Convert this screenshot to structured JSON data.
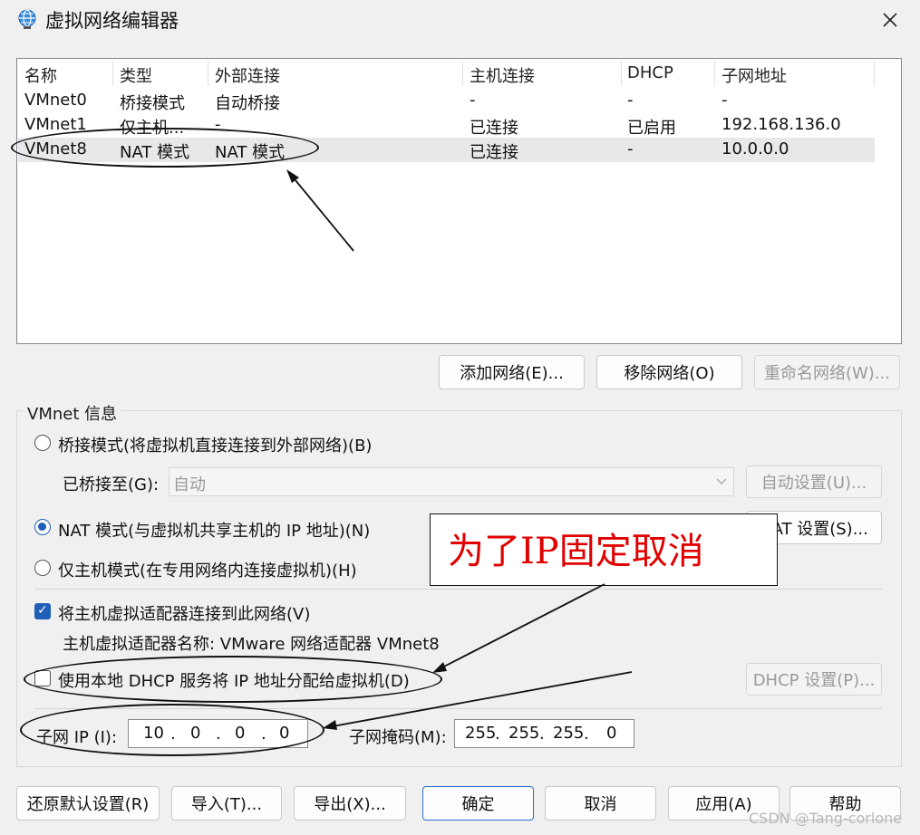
{
  "window": {
    "title": "虚拟网络编辑器",
    "close_glyph": "✕"
  },
  "list": {
    "columns": [
      "名称",
      "类型",
      "外部连接",
      "主机连接",
      "DHCP",
      "子网地址"
    ],
    "rows": [
      [
        "VMnet0",
        "桥接模式",
        "自动桥接",
        "-",
        "-",
        "-"
      ],
      [
        "VMnet1",
        "仅主机...",
        "-",
        "已连接",
        "已启用",
        "192.168.136.0"
      ],
      [
        "VMnet8",
        "NAT 模式",
        "NAT 模式",
        "已连接",
        "-",
        "10.0.0.0"
      ]
    ]
  },
  "list_buttons": {
    "add": "添加网络(E)...",
    "remove": "移除网络(O)",
    "rename": "重命名网络(W)..."
  },
  "info": {
    "group_title": "VMnet 信息",
    "bridge_radio": "桥接模式(将虚拟机直接连接到外部网络)(B)",
    "bridged_to_label": "已桥接至(G):",
    "bridged_to_value": "自动",
    "auto_settings": "自动设置(U)...",
    "nat_radio": "NAT 模式(与虚拟机共享主机的 IP 地址)(N)",
    "nat_settings": "NAT 设置(S)...",
    "hostonly_radio": "仅主机模式(在专用网络内连接虚拟机)(H)",
    "connect_adapter": "将主机虚拟适配器连接到此网络(V)",
    "adapter_name": "主机虚拟适配器名称: VMware 网络适配器 VMnet8",
    "use_dhcp": "使用本地 DHCP 服务将 IP 地址分配给虚拟机(D)",
    "dhcp_settings": "DHCP 设置(P)...",
    "subnet_ip_label": "子网 IP (I):",
    "subnet_ip": [
      "10",
      "0",
      "0",
      "0"
    ],
    "subnet_mask_label": "子网掩码(M):",
    "subnet_mask": [
      "255",
      "255",
      "255",
      "0"
    ],
    "selected_mode": "nat",
    "connect_adapter_checked": true,
    "use_dhcp_checked": false
  },
  "annotation": {
    "text": "为了IP固定取消",
    "color": "#e00000"
  },
  "footer": {
    "restore": "还原默认设置(R)",
    "import": "导入(T)...",
    "export": "导出(X)...",
    "ok": "确定",
    "cancel": "取消",
    "apply": "应用(A)",
    "help": "帮助"
  },
  "watermark": "CSDN @Tang-corlone"
}
